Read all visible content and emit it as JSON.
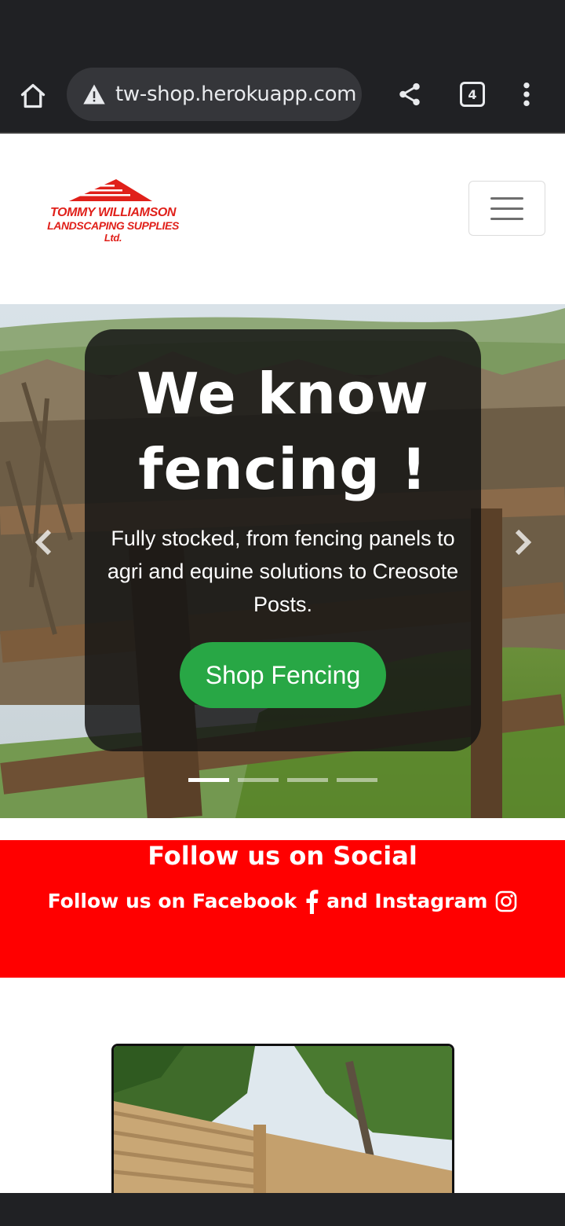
{
  "browser": {
    "url": "tw-shop.herokuapp.com",
    "tab_count": "4",
    "icons": {
      "home": "home-icon",
      "security": "warning-triangle-icon",
      "share": "share-icon",
      "tabs": "tab-switcher-icon",
      "menu": "kebab-menu-icon"
    }
  },
  "header": {
    "logo": {
      "line1": "TOMMY WILLIAMSON",
      "line2": "LANDSCAPING SUPPLIES",
      "line3": "Ltd."
    },
    "menu_icon": "hamburger-icon"
  },
  "hero": {
    "title": "We know fencing !",
    "text": "Fully stocked, from fencing panels to agri and equine solutions to Creosote Posts.",
    "button_label": "Shop Fencing",
    "slide_count": 4,
    "active_slide": 1
  },
  "social": {
    "title": "Follow us on Social",
    "facebook_text": "Follow us on Facebook",
    "and_text": "and Instagram",
    "icons": [
      "facebook-icon",
      "instagram-icon"
    ]
  },
  "colors": {
    "brand_red": "#ff0000",
    "logo_red": "#e0201a",
    "success_green": "#28a745",
    "chrome_dark": "#202124"
  }
}
